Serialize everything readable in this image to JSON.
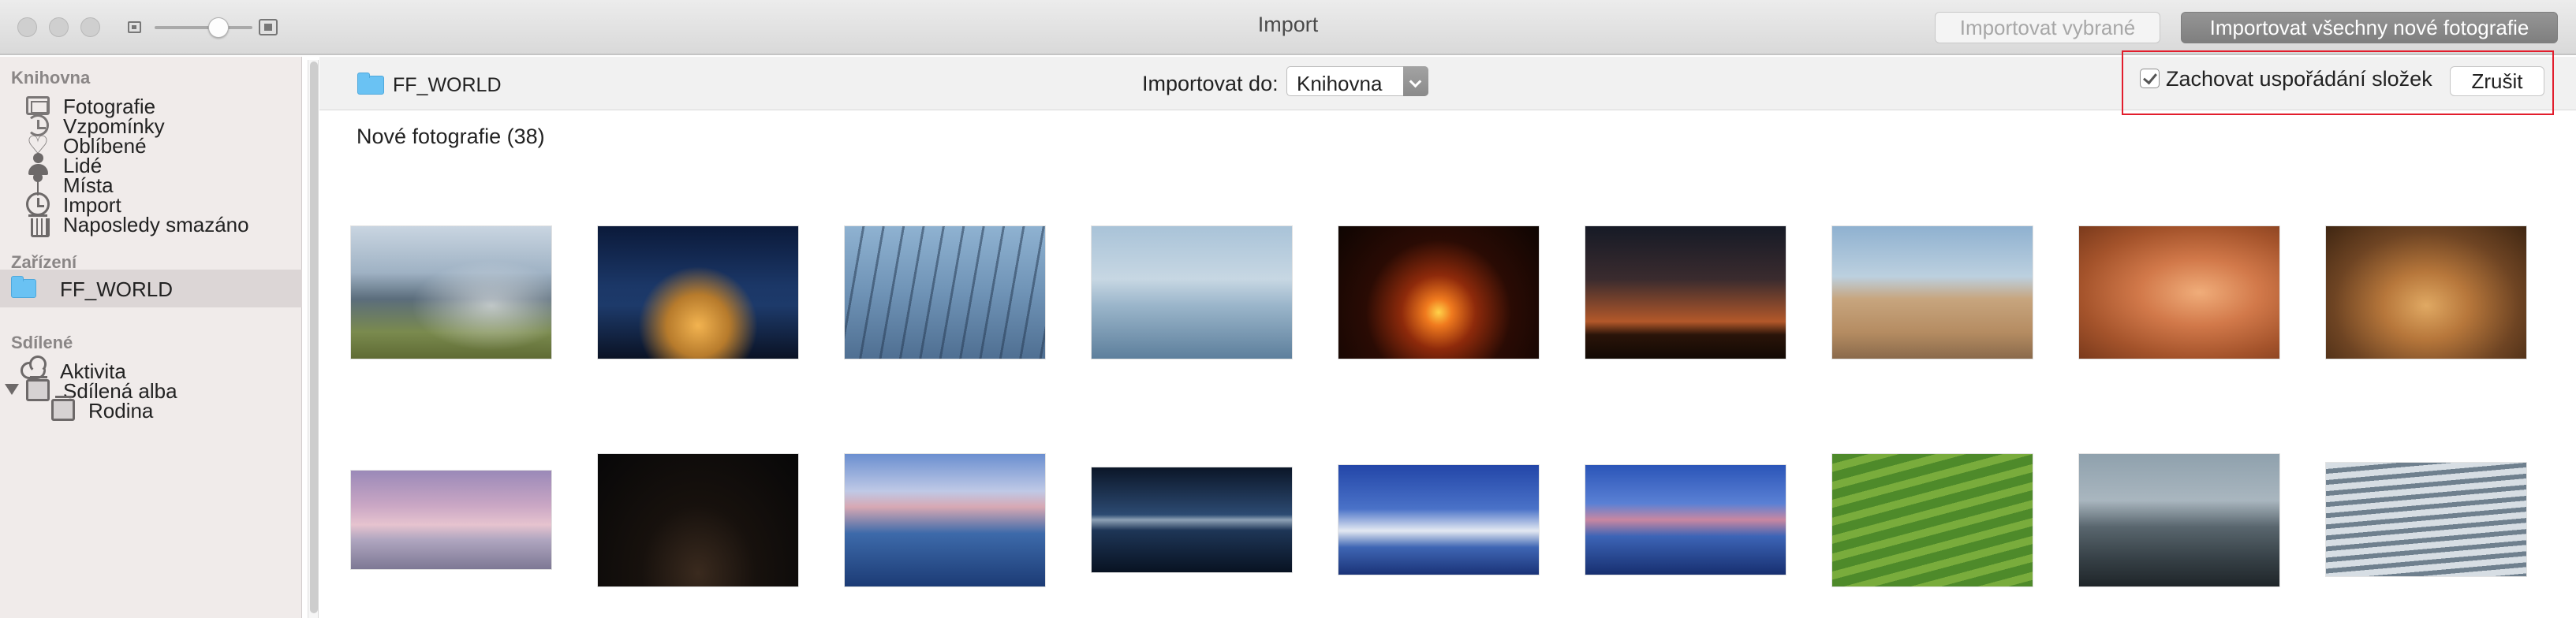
{
  "window": {
    "title": "Import",
    "import_selected_label": "Importovat vybrané",
    "import_all_label": "Importovat všechny nové fotografie"
  },
  "sidebar": {
    "sections": [
      {
        "header": "Knihovna",
        "items": [
          {
            "label": "Fotografie",
            "icon": "photos-icon"
          },
          {
            "label": "Vzpomínky",
            "icon": "memories-icon"
          },
          {
            "label": "Oblíbené",
            "icon": "heart-icon"
          },
          {
            "label": "Lidé",
            "icon": "person-icon"
          },
          {
            "label": "Místa",
            "icon": "pin-icon"
          },
          {
            "label": "Import",
            "icon": "clock-icon"
          },
          {
            "label": "Naposledy smazáno",
            "icon": "trash-icon"
          }
        ]
      },
      {
        "header": "Zařízení",
        "items": [
          {
            "label": "FF_WORLD",
            "icon": "folder-icon",
            "selected": true
          }
        ]
      },
      {
        "header": "Sdílené",
        "items": [
          {
            "label": "Aktivita",
            "icon": "cloud-icon"
          },
          {
            "label": "Sdílená alba",
            "icon": "album-icon"
          },
          {
            "label": "Rodina",
            "icon": "album-icon"
          }
        ]
      }
    ]
  },
  "importbar": {
    "folder_name": "FF_WORLD",
    "import_to_label": "Importovat do:",
    "import_to_value": "Knihovna",
    "keep_folders_label": "Zachovat uspořádání složek",
    "keep_folders_checked": true,
    "cancel_label": "Zrušit"
  },
  "content": {
    "section_title": "Nové fotografie (38)"
  },
  "colors": {
    "folder_blue": "#6ac2f3",
    "highlight_red": "#e21d2c",
    "primary_button_gray": "#8a8a8a"
  }
}
